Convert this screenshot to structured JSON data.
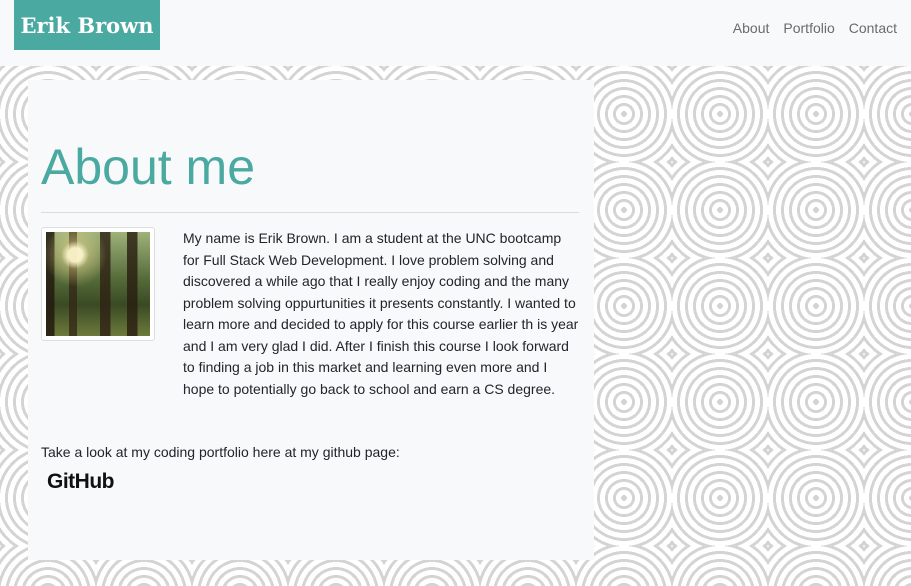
{
  "header": {
    "brand": "Erik Brown",
    "nav": [
      "About",
      "Portfolio",
      "Contact"
    ]
  },
  "main": {
    "title": "About me",
    "photo_alt": "forest photo",
    "bio": "My name is Erik Brown. I am a student at the UNC bootcamp for Full Stack Web Development. I love problem solving and discovered a while ago that I really enjoy coding and the many problem solving oppurtunities it presents constantly. I wanted to learn more and decided to apply for this course earlier th is year and I am very glad I did. After I finish this course I look forward to finding a job in this market and learning even more and I hope to potentially go back to school and earn a CS degree.",
    "portfolio_note": "Take a look at my coding portfolio here at my github page:",
    "github_label": "GitHub"
  },
  "colors": {
    "accent": "#4aa9a1",
    "panel": "#f8f9fa",
    "nav_text": "#6b6b6b"
  }
}
